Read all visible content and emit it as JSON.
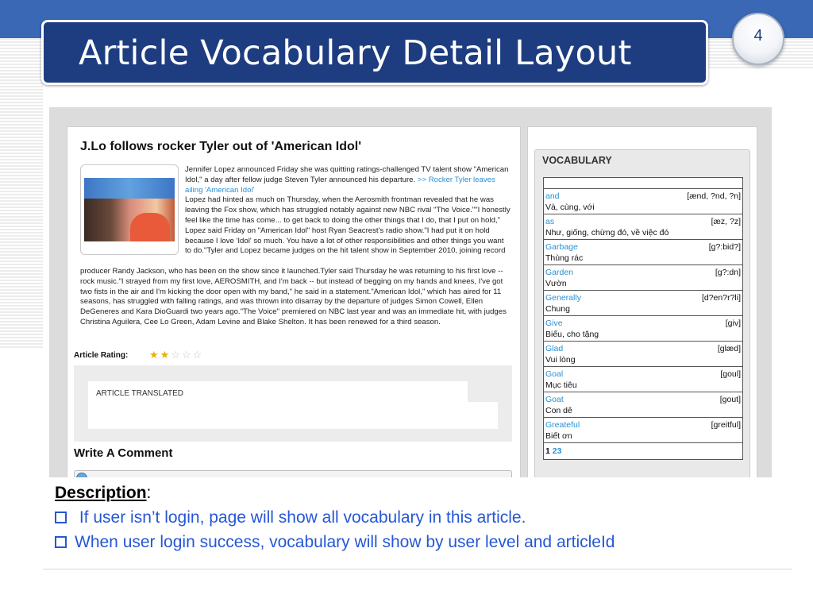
{
  "slide": {
    "title": "Article Vocabulary Detail Layout",
    "page_number": "4",
    "colors": {
      "title_box": "#1e3d80",
      "band": "#3a68b5",
      "description_text": "#2557d6"
    }
  },
  "article": {
    "title": "J.Lo follows rocker Tyler out of 'American Idol'",
    "body_right": "Jennifer Lopez announced Friday she was quitting ratings-challenged TV talent show \"American Idol,\" a day after fellow judge Steven Tyler announced his departure.",
    "related_link": ">> Rocker Tyler leaves ailing 'American Idol'",
    "body_right_2": "Lopez had hinted as much on Thursday, when the Aerosmith frontman revealed that he was leaving the Fox show, which has struggled notably against new NBC rival \"The Voice.\"\"I honestly feel like the time has come... to get back to doing the other things that I do, that I put on hold,\" Lopez said Friday on \"American Idol\" host Ryan Seacrest's radio show.\"I had put it on hold because I love 'Idol' so much. You have a lot of other responsibilities and other things you want to do.\"Tyler and Lopez became judges on the hit talent show in September 2010, joining record",
    "body_full": "producer Randy Jackson, who has been on the show since it launched.Tyler said Thursday he was returning to his first love -- rock music.\"I strayed from my first love, AEROSMITH, and I'm back -- but instead of begging on my hands and knees, I've got two fists in the air and I'm kicking the door open with my band,\" he said in a statement.\"American Idol,\" which has aired for 11 seasons, has struggled with falling ratings, and was thrown into disarray by the departure of judges Simon Cowell, Ellen DeGeneres and Kara DioGuardi two years ago.\"The Voice\" premiered on NBC last year and was an immediate hit, with judges Christina Aguilera, Cee Lo Green, Adam Levine and Blake Shelton. It has been renewed for a third season.",
    "rating_label": "Article Rating:",
    "rating_value": 2,
    "rating_max": 5,
    "translated_label": "ARTICLE TRANSLATED",
    "comment_title": "Write A Comment"
  },
  "vocabulary": {
    "header": "VOCABULARY",
    "items": [
      {
        "word": "and",
        "pron": "[ænd, ?nd, ?n]",
        "meaning": "Và, cùng, với"
      },
      {
        "word": "as",
        "pron": "[æz, ?z]",
        "meaning": "Như, giống, chừng đó, về việc đó"
      },
      {
        "word": "Garbage",
        "pron": "[g?:bid?]",
        "meaning": "Thùng rác"
      },
      {
        "word": "Garden",
        "pron": "[g?:dn]",
        "meaning": "Vườn"
      },
      {
        "word": "Generally",
        "pron": "[d?en?r?li]",
        "meaning": "Chung"
      },
      {
        "word": "Give",
        "pron": "[giv]",
        "meaning": "Biếu, cho tặng"
      },
      {
        "word": "Glad",
        "pron": "[glæd]",
        "meaning": "Vui lòng"
      },
      {
        "word": "Goal",
        "pron": "[goul]",
        "meaning": "Mục tiêu"
      },
      {
        "word": "Goat",
        "pron": "[gout]",
        "meaning": "Con dê"
      },
      {
        "word": "Greateful",
        "pron": "[greitful]",
        "meaning": "Biết ơn"
      }
    ],
    "pages": {
      "current": "1",
      "others": [
        "2",
        "3"
      ]
    }
  },
  "description": {
    "heading": "Description",
    "heading_suffix": ":",
    "items": [
      " If user isn’t login, page will show all vocabulary in this article.",
      "When user login success, vocabulary will show by user level and articleId"
    ]
  }
}
